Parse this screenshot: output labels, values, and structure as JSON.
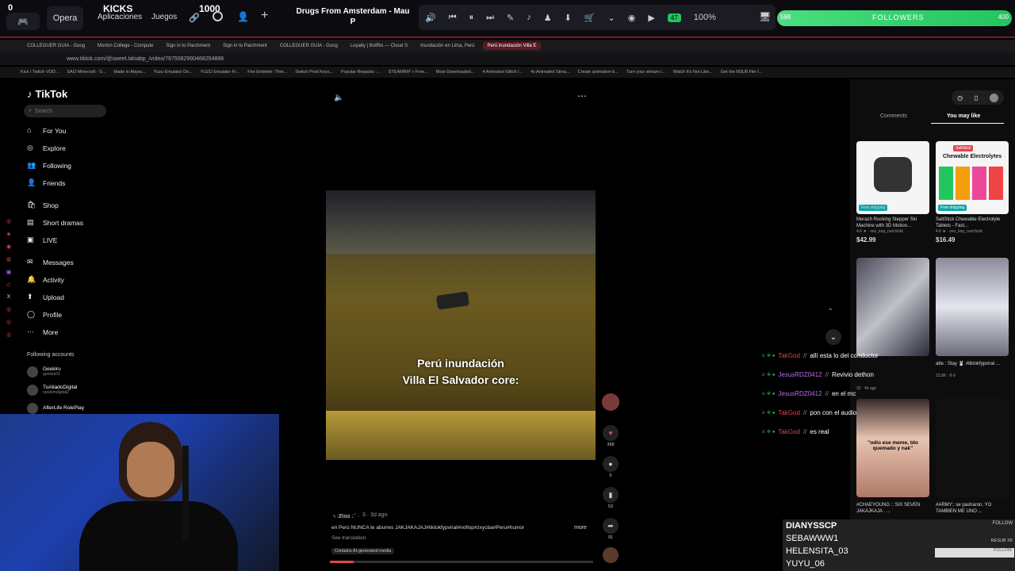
{
  "topbar": {
    "counter_left": "0",
    "opera_label": "Opera",
    "kicks_label": "KICKS",
    "kicks_value": "1000",
    "apps_label": "Aplicaciones",
    "games_label": "Juegos",
    "song_title": "Drugs From Amsterdam - Mau P",
    "battery": "100%",
    "followers_label": "FOLLOWERS",
    "followers_current": "588",
    "followers_goal": "400"
  },
  "browser": {
    "tabs": [
      "COLLEGUER GUIA - Goog",
      "Morton College - Compute",
      "Sign in to Parchment",
      "Sign in to Parchment",
      "COLLEGUER GUIA - Goog",
      "Loyalty | BotRix — Cloud S",
      "Inundación en Lima, Perú",
      "Perú inundación Villa E"
    ],
    "active_tab": 7,
    "url": "www.tiktok.com/@sweet.lalsabp_/video/7675082990468254886",
    "bookmarks": [
      "Kick / Twitch VOD...",
      "SAO Minecraft - S...",
      "Made in Abyss...",
      "Yuzu Emulator Do...",
      "YUZU Emulator Fr...",
      "Fire Emblem: Thre...",
      "Switch Prod Keys...",
      "Popular Repacks -...",
      "STEAMRIP » Free...",
      "Most Downloaded...",
      "4 Animated Glitch /...",
      "4x Animated Strea...",
      "Create animation b...",
      "Turn your stream i...",
      "Watch It's Not Like...",
      "Get the M3U8 File f..."
    ]
  },
  "tiktok": {
    "logo": "TikTok",
    "search_placeholder": "Search",
    "nav": [
      "For You",
      "Explore",
      "Following",
      "Friends",
      "Shop",
      "Short dramas",
      "LIVE",
      "Messages",
      "Activity",
      "Upload",
      "Profile",
      "More"
    ],
    "following_accounts_label": "Following accounts",
    "following_accounts": [
      {
        "name": "Geekiru",
        "handle": "geekiru01"
      },
      {
        "name": "TuAliadoDigital",
        "handle": "randomdigital2"
      },
      {
        "name": "AfterLife RolePlay",
        "handle": ""
      }
    ],
    "video": {
      "subtitle_line1": "Perú inundación",
      "subtitle_line2": "Villa El Salvador core:",
      "author": "ヽ:Ƶℓɑɑ ::ﾞ·",
      "age": "3 · 3d ago",
      "caption": "en Perú NUNCA te aburres JAKJAKAJAJ#tiktokfypviral#noflop#zxycba#Peru#humor",
      "more": "more",
      "see_translation": "See translation",
      "ai_label": "Contains AI-generated media",
      "likes": "368",
      "comments": "5",
      "saves": "53",
      "shares": "91"
    },
    "right_tabs": [
      "Comments",
      "You may like"
    ],
    "products": [
      {
        "title": "Merach Rocking Stepper Ski Machine with 3D Motion...",
        "rating": "4.6 ★",
        "sold": "seo_kep_numSold",
        "price": "$42.99",
        "badge": "Free shipping"
      },
      {
        "title": "SaltStick Chewable Electrolyte Tablets - Fast...",
        "rating": "4.6 ★",
        "sold": "seo_kep_numSold",
        "price": "$16.49",
        "badge": "Free shipping",
        "product_label": "Chewable Electrolytes",
        "brand": "SaltStick"
      }
    ],
    "videos": [
      {
        "caption": "",
        "meta": "32 · 4h ago"
      },
      {
        "caption": "atte : Stay 🐰 #tiktokfypviral ...",
        "meta": "13.8K · 8-9"
      },
      {
        "caption": "#CHAEYOUNG :: SIX SEVEN JAKAJKAJA . ...",
        "overlay": "\"odio ese meme, tdo quemado y nak\""
      },
      {
        "caption": "#ARMY:: se pasharon, YO TAMBIEN ME UNO ..."
      }
    ]
  },
  "chat": [
    {
      "user": "TakGod",
      "msg": "allí esta lo del conductor",
      "color": "#e0464b"
    },
    {
      "user": "JesusRDZ0412",
      "msg": "Revivio dethon",
      "color": "#b86cf0"
    },
    {
      "user": "JesusRDZ0412",
      "msg": "en el mc",
      "color": "#b86cf0"
    },
    {
      "user": "TakGod",
      "msg": "pon con el audio",
      "color": "#e0464b"
    },
    {
      "user": "TakGod",
      "msg": "es real",
      "color": "#e0464b"
    }
  ],
  "follower_feed": {
    "names": [
      "DIANYSSCP",
      "SEBAWWW1",
      "HELENSITA_03",
      "YUYU_06"
    ],
    "follow_label": "FOLLOW",
    "resub_label": "RESUB X5"
  }
}
